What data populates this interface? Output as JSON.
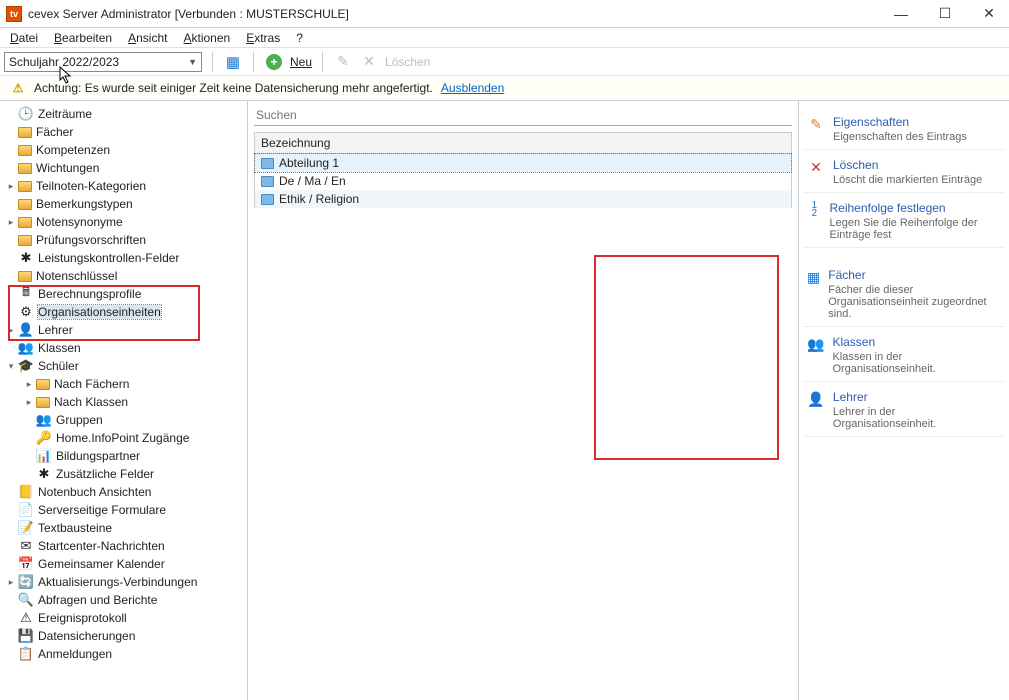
{
  "window": {
    "title": "cevex Server Administrator [Verbunden : MUSTERSCHULE]",
    "app_icon_text": "tv"
  },
  "menu": [
    "Datei",
    "Bearbeiten",
    "Ansicht",
    "Aktionen",
    "Extras",
    "?"
  ],
  "toolbar": {
    "schoolyear": "Schuljahr 2022/2023",
    "new_label": "Neu",
    "delete_label": "Löschen"
  },
  "notice": {
    "text": "Achtung: Es wurde seit einiger Zeit keine Datensicherung mehr angefertigt.",
    "link": "Ausblenden"
  },
  "tree": [
    {
      "indent": 0,
      "exp": "",
      "icon": "clock",
      "label": "Zeiträume"
    },
    {
      "indent": 0,
      "exp": "",
      "icon": "folder",
      "label": "Fächer"
    },
    {
      "indent": 0,
      "exp": "",
      "icon": "folder",
      "label": "Kompetenzen"
    },
    {
      "indent": 0,
      "exp": "",
      "icon": "folder",
      "label": "Wichtungen"
    },
    {
      "indent": 0,
      "exp": ">",
      "icon": "folder",
      "label": "Teilnoten-Kategorien"
    },
    {
      "indent": 0,
      "exp": "",
      "icon": "folder",
      "label": "Bemerkungstypen"
    },
    {
      "indent": 0,
      "exp": ">",
      "icon": "folder",
      "label": "Notensynonyme"
    },
    {
      "indent": 0,
      "exp": "",
      "icon": "folder",
      "label": "Prüfungsvorschriften"
    },
    {
      "indent": 0,
      "exp": "",
      "icon": "redstar",
      "label": "Leistungskontrollen-Felder"
    },
    {
      "indent": 0,
      "exp": "",
      "icon": "folder",
      "label": "Notenschlüssel"
    },
    {
      "indent": 0,
      "exp": "",
      "icon": "calc",
      "label": "Berechnungsprofile"
    },
    {
      "indent": 0,
      "exp": "",
      "icon": "org",
      "label": "Organisationseinheiten",
      "sel": true
    },
    {
      "indent": 0,
      "exp": ">",
      "icon": "person",
      "label": "Lehrer"
    },
    {
      "indent": 0,
      "exp": "",
      "icon": "people",
      "label": "Klassen"
    },
    {
      "indent": 0,
      "exp": "v",
      "icon": "student",
      "label": "Schüler"
    },
    {
      "indent": 1,
      "exp": ">",
      "icon": "subfolder",
      "label": "Nach Fächern"
    },
    {
      "indent": 1,
      "exp": ">",
      "icon": "subfolder",
      "label": "Nach Klassen"
    },
    {
      "indent": 1,
      "exp": "",
      "icon": "group",
      "label": "Gruppen"
    },
    {
      "indent": 1,
      "exp": "",
      "icon": "key",
      "label": "Home.InfoPoint Zugänge"
    },
    {
      "indent": 1,
      "exp": "",
      "icon": "chart",
      "label": "Bildungspartner"
    },
    {
      "indent": 1,
      "exp": "",
      "icon": "redstar",
      "label": "Zusätzliche Felder"
    },
    {
      "indent": 0,
      "exp": "",
      "icon": "book",
      "label": "Notenbuch Ansichten"
    },
    {
      "indent": 0,
      "exp": "",
      "icon": "form",
      "label": "Serverseitige Formulare"
    },
    {
      "indent": 0,
      "exp": "",
      "icon": "text",
      "label": "Textbausteine"
    },
    {
      "indent": 0,
      "exp": "",
      "icon": "mail",
      "label": "Startcenter-Nachrichten"
    },
    {
      "indent": 0,
      "exp": "",
      "icon": "cal",
      "label": "Gemeinsamer Kalender"
    },
    {
      "indent": 0,
      "exp": ">",
      "icon": "sync",
      "label": "Aktualisierungs-Verbindungen"
    },
    {
      "indent": 0,
      "exp": "",
      "icon": "query",
      "label": "Abfragen und Berichte"
    },
    {
      "indent": 0,
      "exp": "",
      "icon": "event",
      "label": "Ereignisprotokoll"
    },
    {
      "indent": 0,
      "exp": "",
      "icon": "backup",
      "label": "Datensicherungen"
    },
    {
      "indent": 0,
      "exp": "",
      "icon": "login",
      "label": "Anmeldungen"
    }
  ],
  "search_placeholder": "Suchen",
  "grid": {
    "header": "Bezeichnung",
    "rows": [
      {
        "label": "Abteilung 1",
        "sel": true
      },
      {
        "label": "De / Ma / En"
      },
      {
        "label": "Ethik / Religion",
        "alt": true
      }
    ]
  },
  "actions_top": [
    {
      "icon": "✎",
      "color": "#e67e22",
      "title": "Eigenschaften",
      "desc": "Eigenschaften des Eintrags"
    },
    {
      "icon": "✕",
      "color": "#d32f2f",
      "title": "Löschen",
      "desc": "Löscht die markierten Einträge"
    },
    {
      "icon": "↕",
      "color": "#1976d2",
      "title": "Reihenfolge festlegen",
      "desc": "Legen Sie die Reihenfolge der Einträge fest",
      "numbered": true
    }
  ],
  "actions_boxed": [
    {
      "icon": "▦",
      "color": "#1976d2",
      "title": "Fächer",
      "desc": "Fächer die dieser Organisationseinheit zugeordnet sind."
    },
    {
      "icon": "👥",
      "color": "#1976d2",
      "title": "Klassen",
      "desc": "Klassen in der Organisationseinheit."
    },
    {
      "icon": "👤",
      "color": "#1976d2",
      "title": "Lehrer",
      "desc": "Lehrer in der Organisationseinheit."
    }
  ]
}
